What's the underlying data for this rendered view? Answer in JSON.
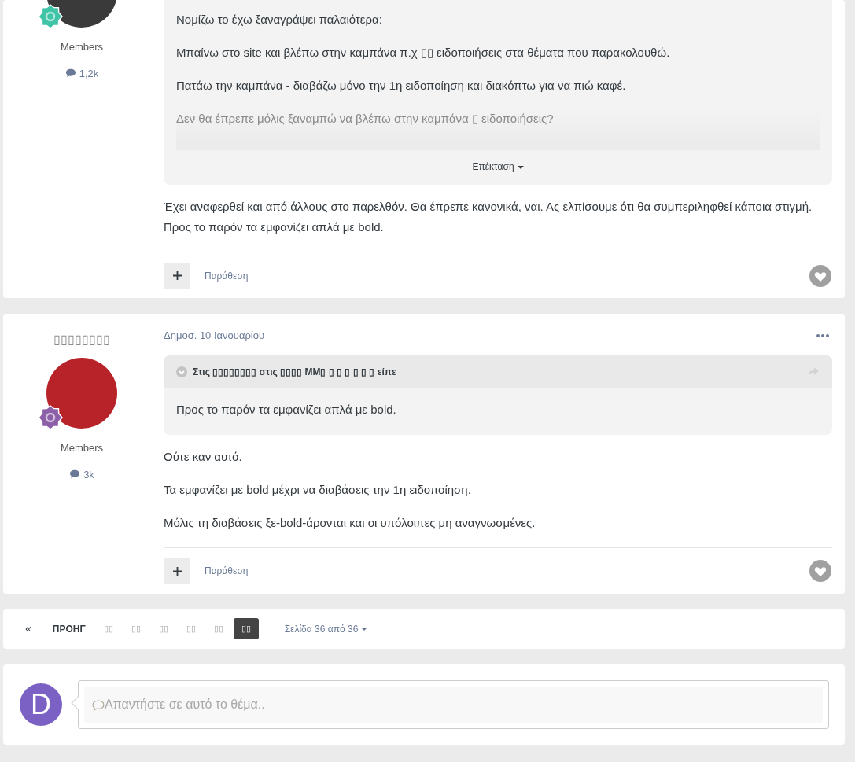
{
  "posts": [
    {
      "group": "Members",
      "post_count": "1,2k",
      "rank_badge": {
        "color": "#3fc4a8"
      },
      "quote": {
        "paragraphs": [
          {
            "text": "Νομίζω το έχω ξαναγράψει παλαιότερα:",
            "faded": false
          },
          {
            "text": "Μπαίνω στο site και βλέπω στην καμπάνα π.χ ▯▯ ειδοποιήσεις στα θέματα που παρακολουθώ.",
            "faded": false
          },
          {
            "text": "Πατάω την καμπάνα - διαβάζω μόνο την 1η ειδοποίηση και διακόπτω για να πιώ καφέ.",
            "faded": false
          },
          {
            "text": "Δεν θα έπρεπε μόλις ξαναμπώ να βλέπω στην καμπάνα ▯ ειδοποιήσεις?",
            "faded": true
          }
        ],
        "expand_label": "Επέκταση"
      },
      "paragraphs": [
        "Έχει αναφερθεί και από άλλους στο παρελθόν. Θα έπρεπε κανονικά, ναι. Ας ελπίσουμε ότι θα συμπεριληφθεί κάποια στιγμή. Προς το παρόν τα εμφανίζει απλά με bold."
      ],
      "quote_label": "Παράθεση",
      "liked": false
    },
    {
      "author": "▯▯▯▯▯▯▯▯",
      "group": "Members",
      "post_count": "3k",
      "rank_badge": {
        "color": "#8d5fa8"
      },
      "date": "Δημοσ. 10 Ιανουαρίου",
      "quote": {
        "header": "Στις ▯▯▯▯▯▯▯▯ στις ▯▯▯▯ ΜΜ▯ ▯ ▯ ▯ ▯ ▯ ▯ είπε",
        "paragraphs": [
          {
            "text": "Προς το παρόν τα εμφανίζει απλά με bold.",
            "faded": false
          }
        ]
      },
      "paragraphs": [
        "Ούτε καν αυτό.",
        "Τα εμφανίζει με bold μέχρι να διαβάσεις την 1η ειδοποίηση.",
        "Μόλις τη διαβάσεις ξε-bold-άρονται και οι υπόλοιπες μη αναγνωσμένες."
      ],
      "quote_label": "Παράθεση",
      "liked": false
    }
  ],
  "pagination": {
    "first": "«",
    "prev": "ΠΡΟΗΓ",
    "pages": [
      {
        "label": "▯▯",
        "selected": false
      },
      {
        "label": "▯▯",
        "selected": false
      },
      {
        "label": "▯▯",
        "selected": false
      },
      {
        "label": "▯▯",
        "selected": false
      },
      {
        "label": "▯▯",
        "selected": false
      },
      {
        "label": "▯▯",
        "selected": true
      }
    ],
    "page_info": "Σελίδα 36 από 36"
  },
  "reply": {
    "avatar_letter": "D",
    "placeholder": "Απαντήστε σε αυτό το θέμα.."
  }
}
